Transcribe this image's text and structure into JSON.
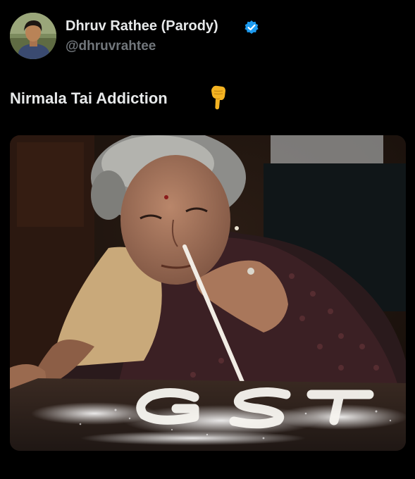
{
  "post": {
    "author": {
      "display_name": "Dhruv Rathee (Parody)",
      "handle": "@dhruvrahtee",
      "verified": true,
      "verified_icon": "verified-badge-icon",
      "avatar_icon": "avatar-photo"
    },
    "text": "Nirmala Tai Addiction",
    "emoji": "backhand-index-pointing-down",
    "media": {
      "kind": "photo",
      "visible_text": "GST"
    }
  },
  "colors": {
    "background": "#000000",
    "primary_text": "#e7e9ea",
    "secondary_text": "#71767b",
    "verified_blue": "#1d9bf0"
  }
}
